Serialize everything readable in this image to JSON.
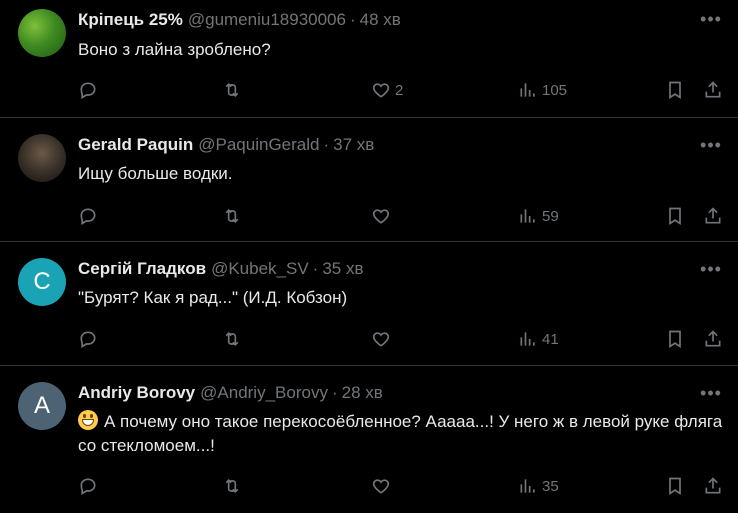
{
  "tweets": [
    {
      "name": "Кріпець 25%",
      "handle": "@gumeniu18930006",
      "time": "48 хв",
      "text": "Воно з лайна зроблено?",
      "avatar_letter": "",
      "likes": "2",
      "views": "105"
    },
    {
      "name": "Gerald Paquin",
      "handle": "@PaquinGerald",
      "time": "37 хв",
      "text": "Ищу больше водки.",
      "avatar_letter": "",
      "likes": "",
      "views": "59"
    },
    {
      "name": "Сергій Гладков",
      "handle": "@Kubek_SV",
      "time": "35 хв",
      "text": "\"Бурят? Как я рад...\" (И.Д. Кобзон)",
      "avatar_letter": "С",
      "likes": "",
      "views": "41"
    },
    {
      "name": "Andriy Borovy",
      "handle": "@Andriy_Borovy",
      "time": "28 хв",
      "text": "А почему оно такое перекосоёбленное? Ааааа...! У него ж в левой руке фляга со стекломоем...!",
      "avatar_letter": "A",
      "likes": "",
      "views": "35"
    }
  ],
  "icons": {
    "reply": "reply-icon",
    "retweet": "retweet-icon",
    "like": "heart-icon",
    "views": "views-icon",
    "bookmark": "bookmark-icon",
    "share": "share-icon",
    "more": "more-icon"
  },
  "colors": {
    "background": "#000000",
    "text": "#e7e9ea",
    "muted": "#71767b",
    "divider": "#2f3336"
  }
}
